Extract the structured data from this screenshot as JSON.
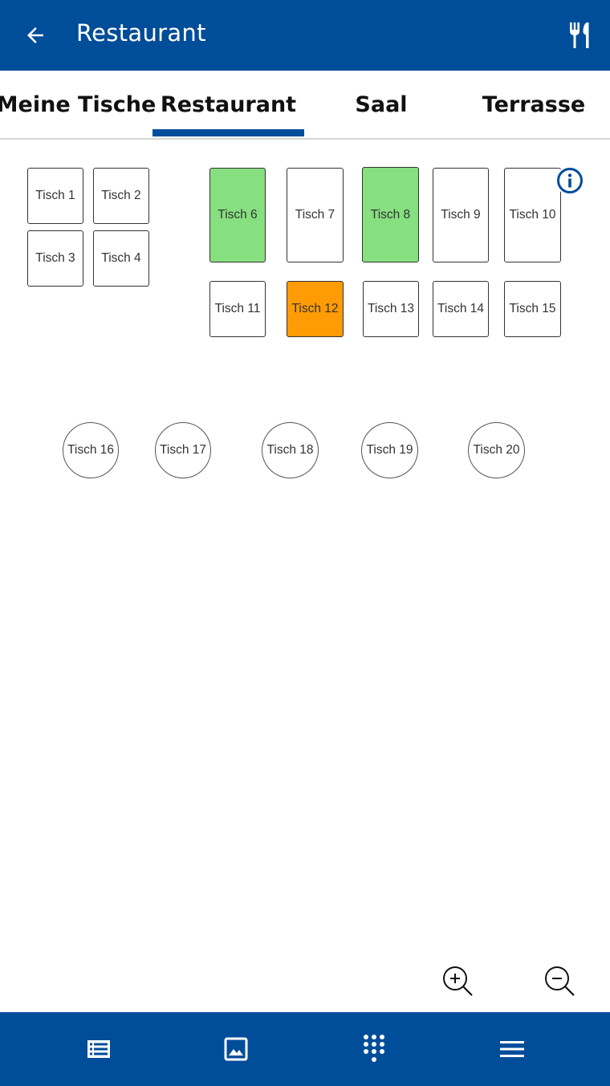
{
  "app_bar": {
    "title": "Restaurant",
    "back_icon": "arrow-left-icon",
    "action_icon": "cutlery-icon"
  },
  "tabs": [
    {
      "label": "Meine Tische",
      "active": false
    },
    {
      "label": "Restaurant",
      "active": true
    },
    {
      "label": "Saal",
      "active": false
    },
    {
      "label": "Terrasse",
      "active": false
    }
  ],
  "tables": [
    {
      "label": "Tisch 1",
      "status": "free"
    },
    {
      "label": "Tisch 2",
      "status": "free"
    },
    {
      "label": "Tisch 3",
      "status": "free"
    },
    {
      "label": "Tisch 4",
      "status": "free"
    },
    {
      "label": "Tisch 6",
      "status": "occupied"
    },
    {
      "label": "Tisch 7",
      "status": "free"
    },
    {
      "label": "Tisch 8",
      "status": "occupied"
    },
    {
      "label": "Tisch 9",
      "status": "free"
    },
    {
      "label": "Tisch 10",
      "status": "free"
    },
    {
      "label": "Tisch 11",
      "status": "free"
    },
    {
      "label": "Tisch 12",
      "status": "pending"
    },
    {
      "label": "Tisch 13",
      "status": "free"
    },
    {
      "label": "Tisch 14",
      "status": "free"
    },
    {
      "label": "Tisch 15",
      "status": "free"
    },
    {
      "label": "Tisch 16",
      "status": "free"
    },
    {
      "label": "Tisch 17",
      "status": "free"
    },
    {
      "label": "Tisch 18",
      "status": "free"
    },
    {
      "label": "Tisch 19",
      "status": "free"
    },
    {
      "label": "Tisch 20",
      "status": "free"
    }
  ],
  "status_colors": {
    "free": "#ffffff",
    "occupied": "#86e07f",
    "pending": "#ff9b05"
  },
  "colors": {
    "primary": "#004d99",
    "divider": "#d6d6d6"
  },
  "floor_controls": {
    "info_icon": "info-icon",
    "zoom_in_icon": "zoom-in-icon",
    "zoom_out_icon": "zoom-out-icon"
  },
  "bottom_nav": [
    {
      "icon": "list-icon"
    },
    {
      "icon": "image-icon"
    },
    {
      "icon": "dialpad-icon"
    },
    {
      "icon": "menu-icon"
    }
  ]
}
